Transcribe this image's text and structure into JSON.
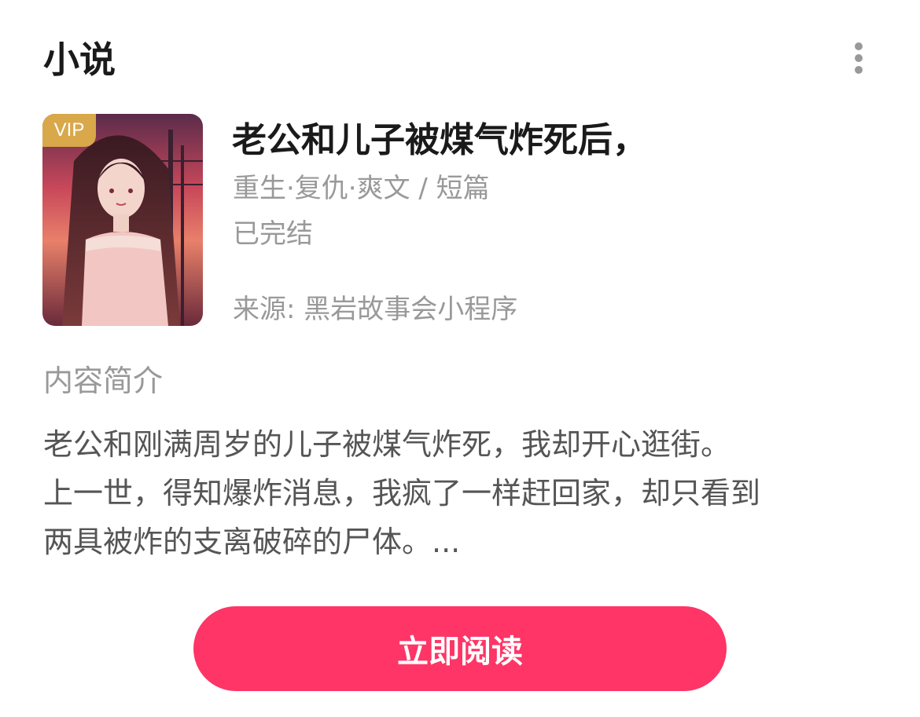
{
  "header": {
    "title": "小说",
    "more_icon": "more-vertical-icon"
  },
  "book": {
    "badge": "VIP",
    "title": "老公和儿子被煤气炸死后，",
    "tags": "重生·复仇·爽文 / 短篇",
    "status": "已完结",
    "source": "来源: 黑岩故事会小程序"
  },
  "synopsis": {
    "label": "内容简介",
    "lines": [
      "老公和刚满周岁的儿子被煤气炸死，我却开心逛街。",
      "上一世，得知爆炸消息，我疯了一样赶回家，却只看到",
      "两具被炸的支离破碎的尸体。..."
    ]
  },
  "action": {
    "read_label": "立即阅读"
  },
  "colors": {
    "accent": "#fe3566",
    "vip": "#d8a84a",
    "muted": "#999999",
    "body": "#555555"
  }
}
